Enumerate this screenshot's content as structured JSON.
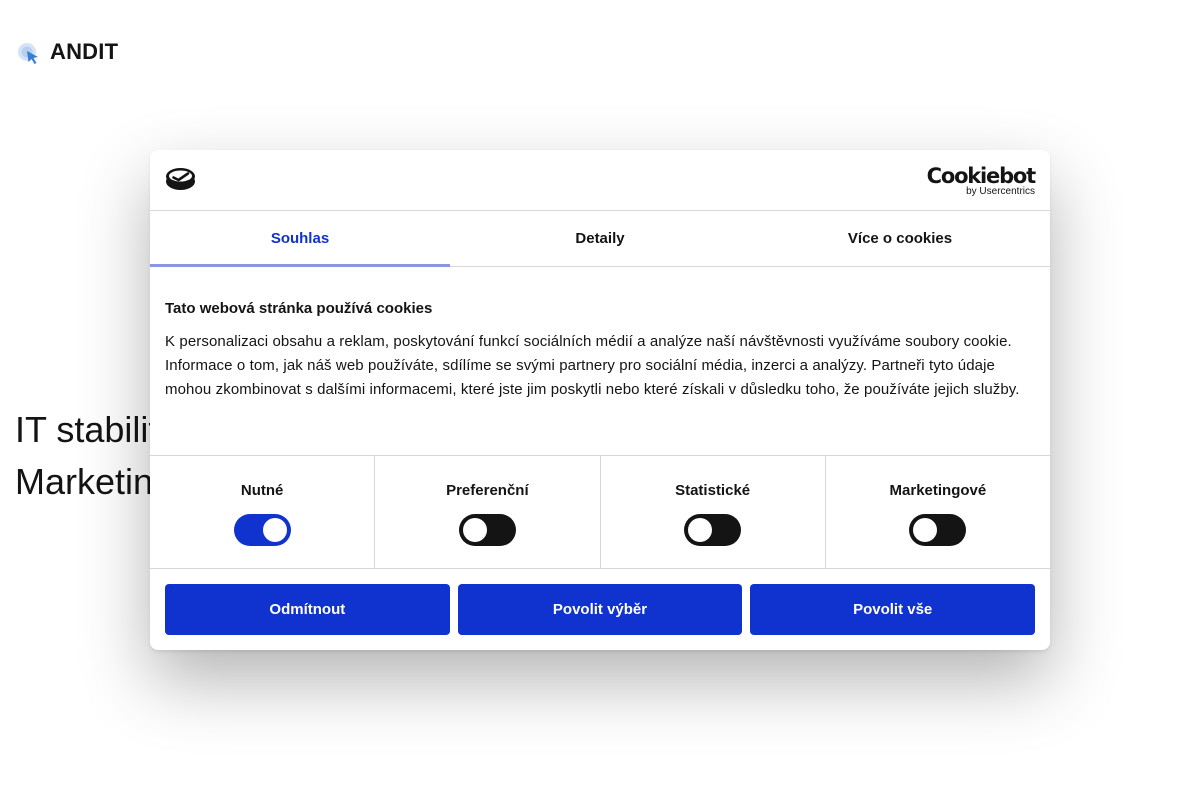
{
  "site": {
    "brand": "ANDIT",
    "hero_line1": "IT stabilit",
    "hero_line2": "Marketin"
  },
  "consent": {
    "provider_brand": "Cookiebot",
    "provider_sub": "by Usercentrics",
    "tabs": [
      {
        "label": "Souhlas",
        "active": true
      },
      {
        "label": "Detaily",
        "active": false
      },
      {
        "label": "Více o cookies",
        "active": false
      }
    ],
    "title": "Tato webová stránka používá cookies",
    "body": "K personalizaci obsahu a reklam, poskytování funkcí sociálních médií a analýze naší návštěvnosti využíváme soubory cookie. Informace o tom, jak náš web používáte, sdílíme se svými partnery pro sociální média, inzerci a analýzy. Partneři tyto údaje mohou zkombinovat s dalšími informacemi, které jste jim poskytli nebo které získali v důsledku toho, že používáte jejich služby.",
    "toggles": [
      {
        "label": "Nutné",
        "on": true
      },
      {
        "label": "Preferenční",
        "on": false
      },
      {
        "label": "Statistické",
        "on": false
      },
      {
        "label": "Marketingové",
        "on": false
      }
    ],
    "buttons": {
      "deny": "Odmítnout",
      "allow_selection": "Povolit výběr",
      "allow_all": "Povolit vše"
    }
  },
  "colors": {
    "accent": "#1032cf",
    "tab_underline": "#8b95e6",
    "toggle_off": "#141414",
    "text": "#141414"
  },
  "icons": {
    "site_logo": "cursor-click-icon",
    "cookie_logo": "cookie-icon"
  }
}
